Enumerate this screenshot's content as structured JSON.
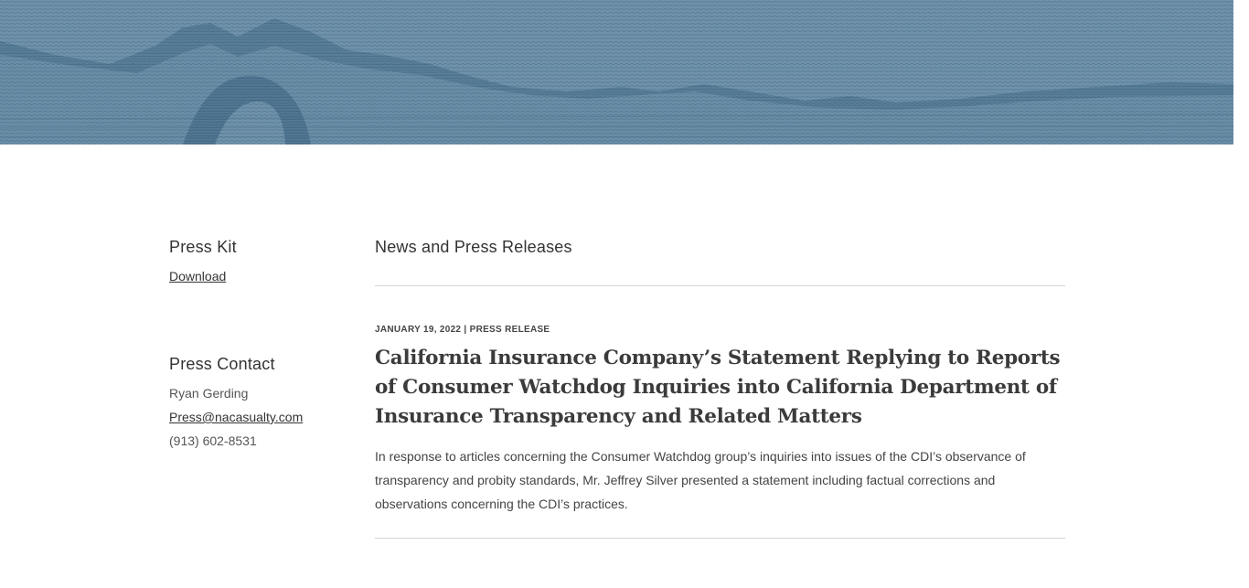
{
  "hero": {
    "image": "engraved-mountain-landscape",
    "colors": {
      "light": "#6b8ea6",
      "dark": "#3e6580"
    }
  },
  "sidebar": {
    "press_kit": {
      "heading": "Press Kit",
      "link": "Download"
    },
    "press_contact": {
      "heading": "Press Contact",
      "name": "Ryan Gerding",
      "email": "Press@nacasualty.com",
      "phone": "(913) 602-8531"
    }
  },
  "main": {
    "section_title": "News and Press Releases",
    "articles": [
      {
        "date": "JANUARY 19, 2022",
        "separator": "|",
        "category": "PRESS RELEASE",
        "title": "California Insurance Company’s Statement Replying to Reports of Consumer Watchdog Inquiries into California Department of Insurance Transparency and Related Matters",
        "summary": "In response to articles concerning the Consumer Watchdog group’s inquiries into issues of the CDI’s observance of transparency and probity standards, Mr. Jeffrey Silver presented a statement including factual corrections and observations concerning the CDI’s practices."
      }
    ]
  }
}
